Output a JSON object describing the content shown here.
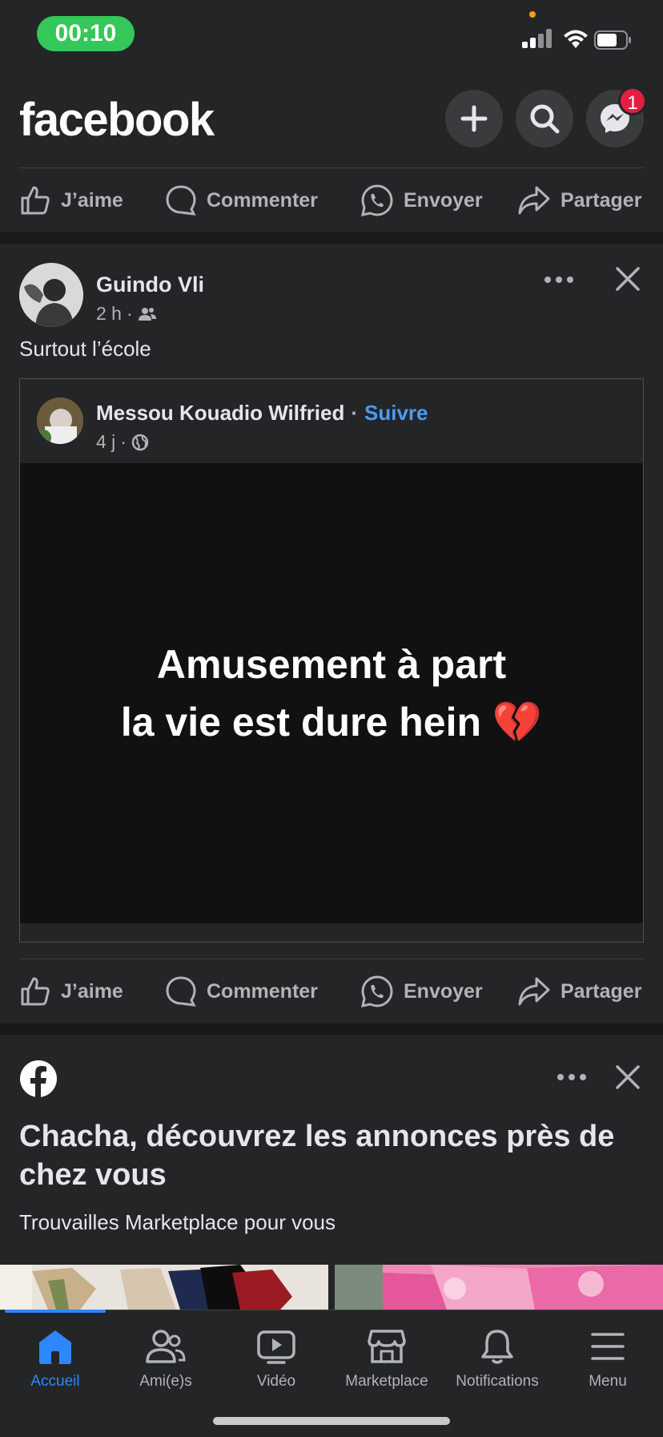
{
  "status_bar": {
    "time": "00:10"
  },
  "header": {
    "logo": "facebook",
    "messenger_badge": "1"
  },
  "actions": {
    "like": "J’aime",
    "comment": "Commenter",
    "send": "Envoyer",
    "share": "Partager"
  },
  "post": {
    "author": "Guindo Vli",
    "time": "2 h",
    "text": "Surtout l’école",
    "shared": {
      "author": "Messou Kouadio Wilfried",
      "follow": "Suivre",
      "time": "4 j",
      "media_line1": "Amusement à part",
      "media_line2": "la vie est dure hein 💔"
    }
  },
  "promo": {
    "title": "Chacha, découvrez les annonces près de chez vous",
    "subtitle": "Trouvailles Marketplace pour vous"
  },
  "tabs": [
    {
      "label": "Accueil",
      "icon": "home-icon",
      "active": true
    },
    {
      "label": "Ami(e)s",
      "icon": "friends-icon"
    },
    {
      "label": "Vidéo",
      "icon": "video-icon"
    },
    {
      "label": "Marketplace",
      "icon": "marketplace-icon"
    },
    {
      "label": "Notifications",
      "icon": "bell-icon"
    },
    {
      "label": "Menu",
      "icon": "menu-icon"
    }
  ],
  "colors": {
    "background": "#242526",
    "accent": "#2d88ff",
    "status_pill": "#34c759",
    "badge": "#e41e3f"
  }
}
